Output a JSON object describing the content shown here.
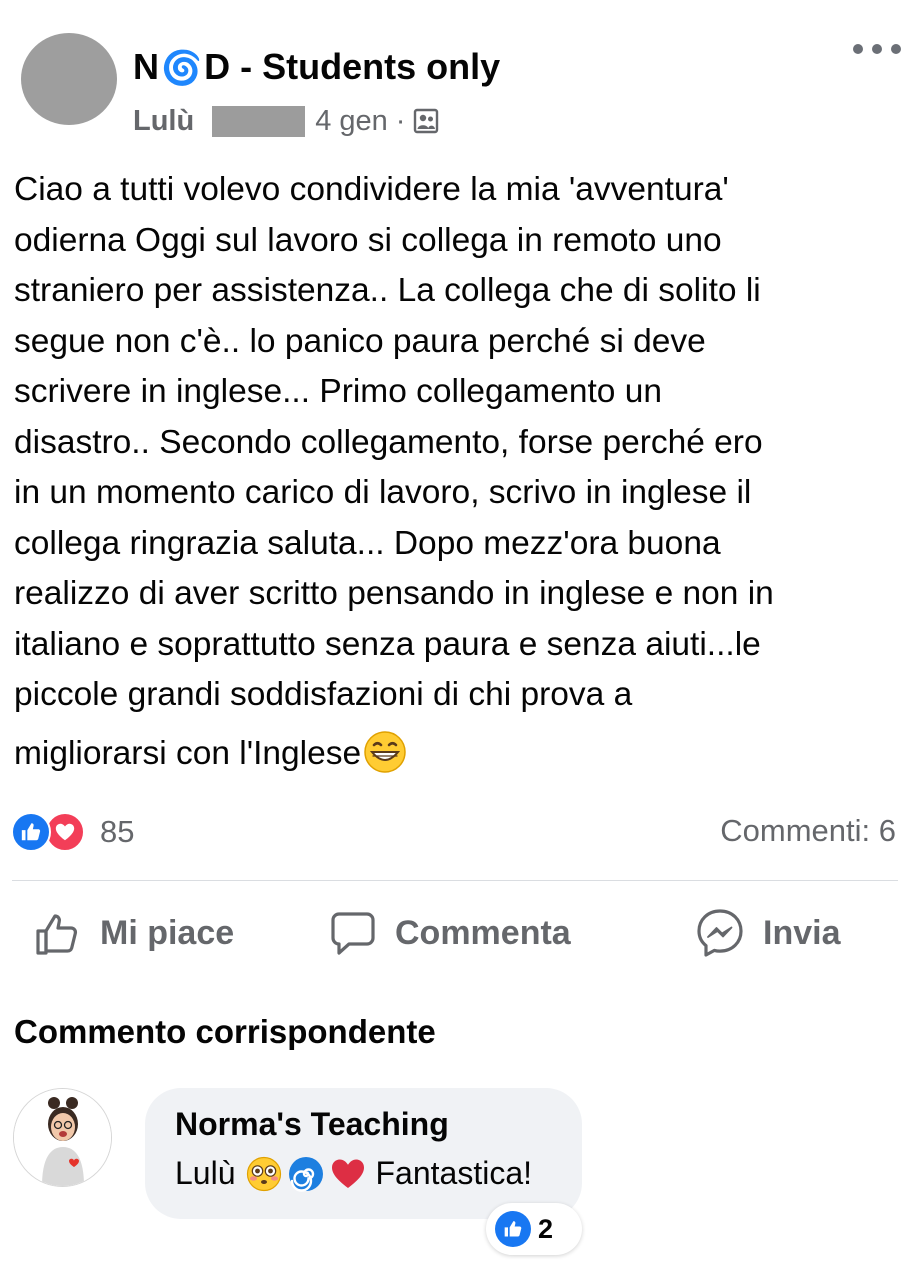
{
  "post": {
    "group_name_prefix": "N",
    "group_name_emoji": "🌀",
    "group_name_suffix": "D - Students only",
    "author": "Lulù",
    "date": "4 gen",
    "separator": "·",
    "audience_icon": "group-members-icon",
    "text_lines": [
      "Ciao a tutti volevo condividere la mia 'avventura'",
      "odierna Oggi sul lavoro si collega in remoto uno",
      "straniero per assistenza.. La collega che di solito li",
      "segue non c'è.. lo panico paura perché si deve",
      "scrivere in inglese... Primo collegamento un",
      "disastro.. Secondo collegamento, forse perché ero",
      "in un momento carico di lavoro, scrivo in inglese il",
      "collega ringrazia saluta... Dopo mezz'ora buona",
      "realizzo di aver scritto pensando in inglese e non in",
      "italiano e soprattutto senza paura e senza aiuti...le",
      "piccole grandi soddisfazioni di chi prova a"
    ],
    "text_last_line": "migliorarsi con l'Inglese",
    "text_last_emoji": "grinning-face-emoji"
  },
  "stats": {
    "reaction_count": "85",
    "comments_label": "Commenti: 6"
  },
  "actions": {
    "like": "Mi piace",
    "comment": "Commenta",
    "share": "Invia"
  },
  "relevant_comment": {
    "section_title": "Commento corrispondente",
    "author": "Norma's Teaching",
    "text_start": "Lulù",
    "emojis": [
      "flushed-face-emoji",
      "spiral-emoji",
      "red-heart-emoji"
    ],
    "text_end": "Fantastica!",
    "like_count": "2"
  },
  "colors": {
    "facebook_blue": "#1877f2",
    "love_red": "#f33e58",
    "secondary_text": "#65676b",
    "bubble_bg": "#f0f2f5"
  }
}
